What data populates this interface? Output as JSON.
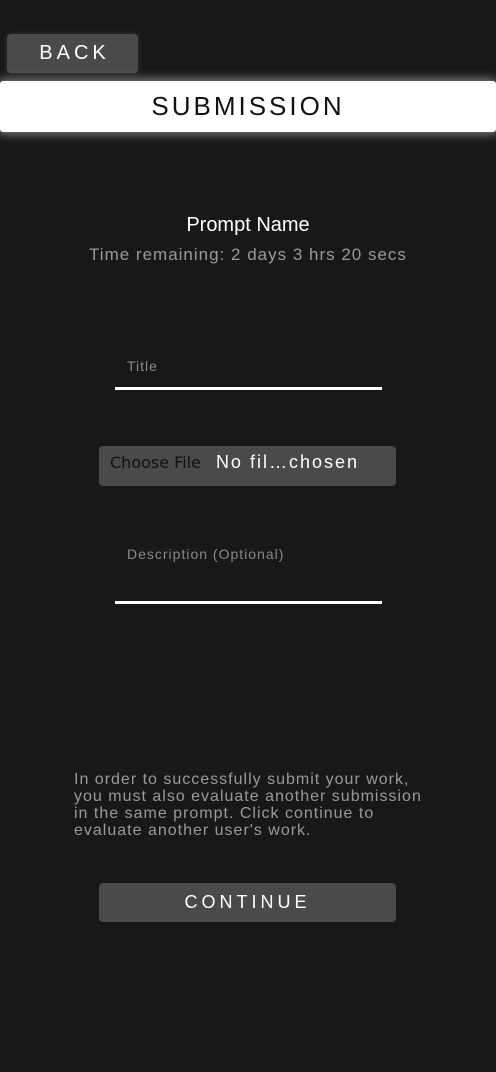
{
  "nav": {
    "back_label": "BACK"
  },
  "header": {
    "title": "SUBMISSION"
  },
  "prompt": {
    "name": "Prompt Name",
    "time_remaining": "Time remaining: 2 days 3 hrs 20 secs"
  },
  "form": {
    "title_label": "Title",
    "title_value": "",
    "file_button_label": "Choose File",
    "file_status": "No fil…chosen",
    "description_label": "Description (Optional)",
    "description_value": ""
  },
  "info": {
    "message": "In order to successfully submit your work, you must also evaluate another submission in the same prompt. Click continue to evaluate another user's work."
  },
  "actions": {
    "continue_label": "CONTINUE"
  },
  "colors": {
    "background": "#181818",
    "button": "#4a4a4a",
    "header_bar": "#ffffff",
    "muted_text": "#9a9a9a"
  }
}
